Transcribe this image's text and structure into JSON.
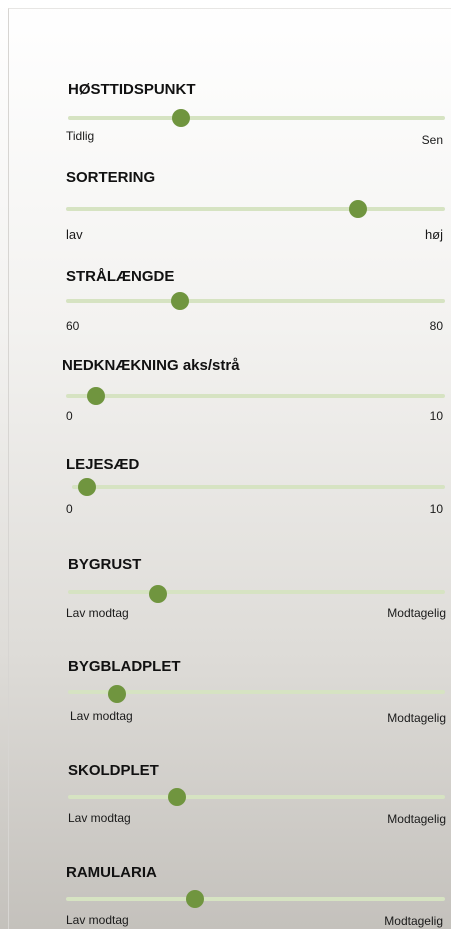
{
  "sliders": [
    {
      "title": "HØSTTIDSPUNKT",
      "min_label": "Tidlig",
      "max_label": "Sen",
      "value": 0.3
    },
    {
      "title": "SORTERING",
      "min_label": "lav",
      "max_label": "høj",
      "value": 0.77
    },
    {
      "title": "STRÅLÆNGDE",
      "min_label": "60",
      "max_label": "80",
      "value": 0.3
    },
    {
      "title": "NEDKNÆKNING aks/strå",
      "min_label": "0",
      "max_label": "10",
      "value": 0.08
    },
    {
      "title": "LEJESÆD",
      "min_label": "0",
      "max_label": "10",
      "value": 0.04
    },
    {
      "title": "BYGRUST",
      "min_label": "Lav modtag",
      "max_label": "Modtagelig",
      "value": 0.24
    },
    {
      "title": "BYGBLADPLET",
      "min_label": "Lav modtag",
      "max_label": "Modtagelig",
      "value": 0.13
    },
    {
      "title": "SKOLDPLET",
      "min_label": "Lav modtag",
      "max_label": "Modtagelig",
      "value": 0.29
    },
    {
      "title": "RAMULARIA",
      "min_label": "Lav modtag",
      "max_label": "Modtagelig",
      "value": 0.34
    }
  ],
  "colors": {
    "track": "#d6e3c2",
    "thumb": "#70953f"
  }
}
